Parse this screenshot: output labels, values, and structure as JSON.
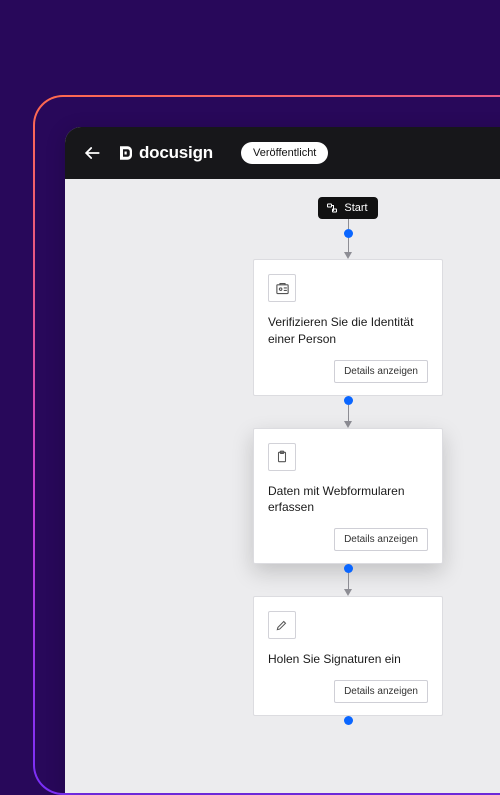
{
  "header": {
    "brand": "docusign",
    "status_pill": "Veröffentlicht"
  },
  "flow": {
    "start_label": "Start",
    "steps": [
      {
        "title": "Verifizieren Sie die Identität einer Person",
        "details_label": "Details anzeigen"
      },
      {
        "title": "Daten mit Webformularen erfassen",
        "details_label": "Details anzeigen"
      },
      {
        "title": "Holen Sie Signaturen ein",
        "details_label": "Details anzeigen"
      }
    ]
  },
  "colors": {
    "node_accent": "#0a66ff",
    "header_bg": "#17171a",
    "bg_purple": "#28085a"
  }
}
